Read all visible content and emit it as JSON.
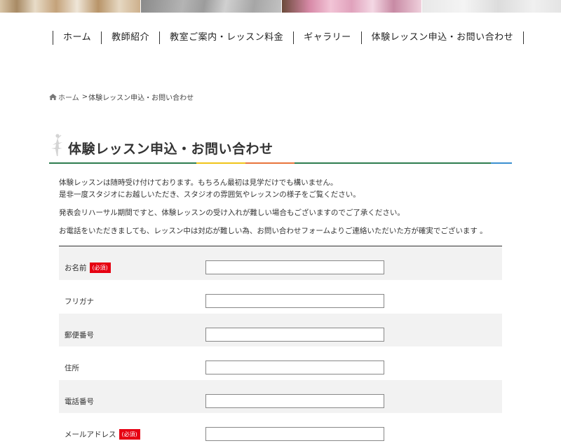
{
  "nav": {
    "items": [
      {
        "label": "ホーム"
      },
      {
        "label": "教師紹介"
      },
      {
        "label": "教室ご案内・レッスン料金"
      },
      {
        "label": "ギャラリー"
      },
      {
        "label": "体験レッスン申込・お問い合わせ"
      }
    ]
  },
  "breadcrumb": {
    "home": "ホーム",
    "separator": ">",
    "current": "体験レッスン申込・お問い合わせ"
  },
  "page": {
    "title": "体験レッスン申込・お問い合わせ",
    "title_icon": "ballerina-icon",
    "divider_colors": [
      "#2e7d4f",
      "#f0c419",
      "#e8743b",
      "#e2e2e2",
      "#3a8fd0"
    ]
  },
  "intro": {
    "line1": "体験レッスンは随時受け付けております。もちろん最初は見学だけでも構いません。",
    "line2": "是非一度スタジオにお越しいただき、スタジオの雰囲気やレッスンの様子をご覧ください。",
    "line3": "発表会リハーサル期間ですと、体験レッスンの受け入れが難しい場合もございますのでご了承ください。",
    "line4": "お電話をいただきましても、レッスン中は対応が難しい為、お問い合わせフォームよりご連絡いただいた方が確実でございます 。"
  },
  "form": {
    "required_label": "(必須)",
    "fields": [
      {
        "label": "お名前",
        "required": true,
        "value": ""
      },
      {
        "label": "フリガナ",
        "required": false,
        "value": ""
      },
      {
        "label": "郵便番号",
        "required": false,
        "value": ""
      },
      {
        "label": "住所",
        "required": false,
        "value": ""
      },
      {
        "label": "電話番号",
        "required": false,
        "value": ""
      },
      {
        "label": "メールアドレス",
        "required": true,
        "value": ""
      }
    ]
  },
  "colors": {
    "required_badge": "#e60012",
    "row_shade": "#f2f2f2"
  }
}
